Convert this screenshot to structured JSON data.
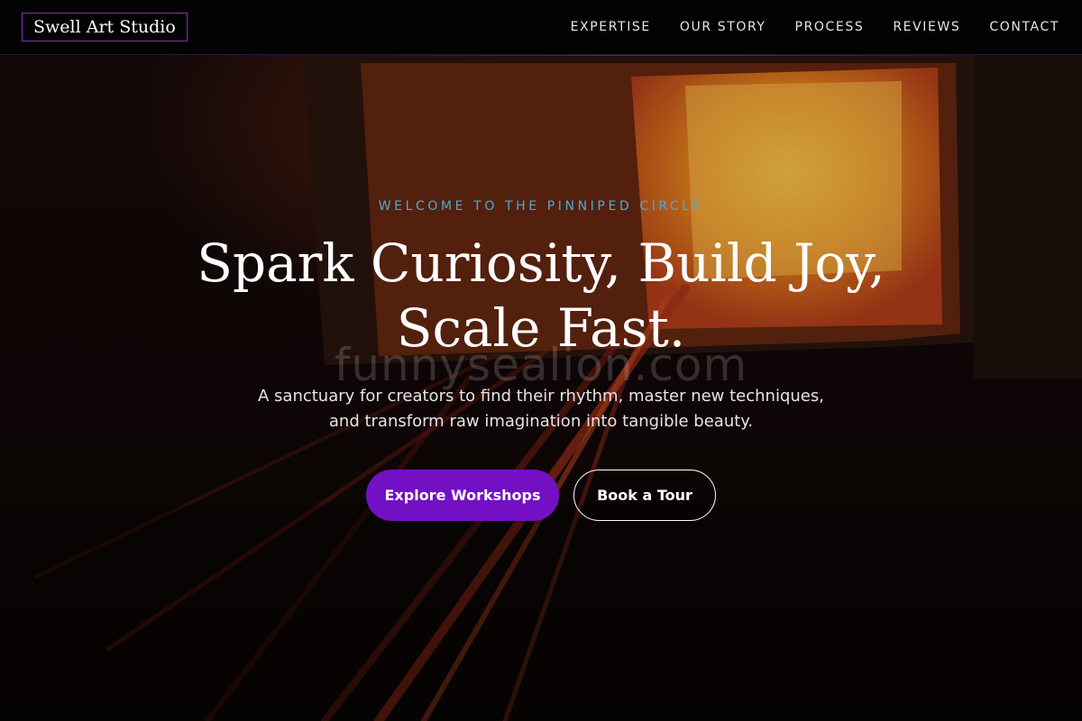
{
  "colors": {
    "accent": "#7410c4",
    "eyebrow": "#4fa9d4",
    "navbar_bg": "#030203",
    "brand_border": "#7a33b8"
  },
  "navbar": {
    "brand": "Swell Art Studio",
    "links": [
      {
        "label": "EXPERTISE"
      },
      {
        "label": "OUR STORY"
      },
      {
        "label": "PROCESS"
      },
      {
        "label": "REVIEWS"
      },
      {
        "label": "CONTACT"
      }
    ]
  },
  "hero": {
    "eyebrow": "WELCOME TO THE PINNIPED CIRCLE",
    "title_line1": "Spark Curiosity, Build Joy,",
    "title_line2": "Scale Fast.",
    "watermark": "funnysealion.com",
    "subtitle_line1": "A sanctuary for creators to find their rhythm, master new techniques,",
    "subtitle_line2": "and transform raw imagination into tangible beauty.",
    "primary_button": "Explore Workshops",
    "secondary_button": "Book a Tour"
  }
}
